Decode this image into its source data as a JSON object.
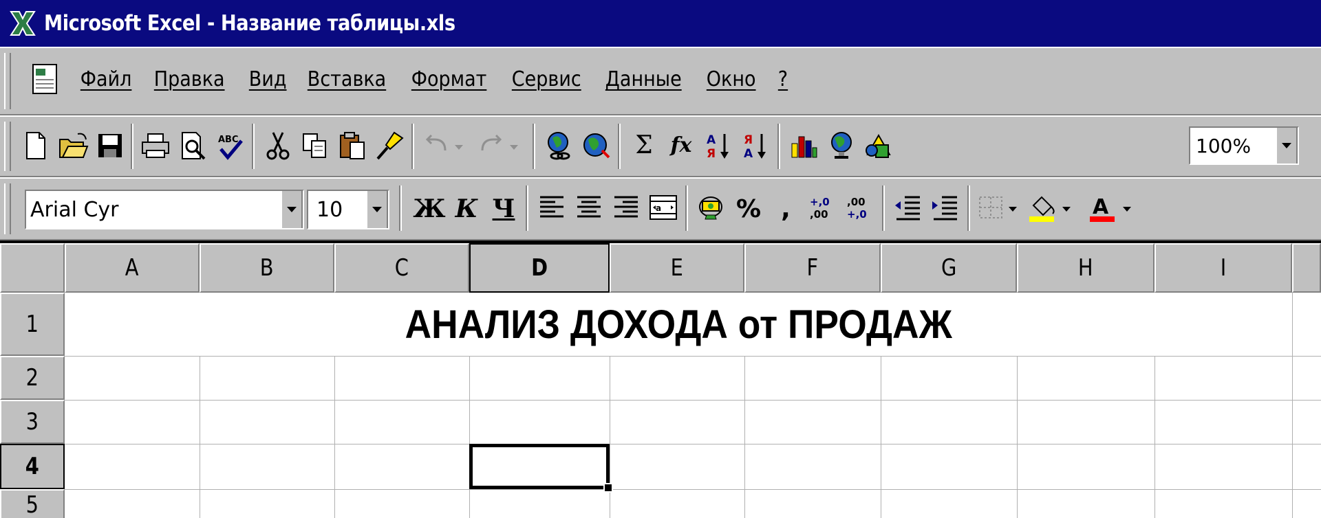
{
  "window": {
    "title": "Microsoft Excel - Название таблицы.xls",
    "colors": {
      "title_bar": "#0a0a80",
      "chrome": "#c0c0c0"
    }
  },
  "menu": {
    "items": [
      "Файл",
      "Правка",
      "Вид",
      "Вставка",
      "Формат",
      "Сервис",
      "Данные",
      "Окно",
      "?"
    ]
  },
  "toolbar_standard": {
    "icons": [
      "new-document-icon",
      "open-folder-icon",
      "save-icon",
      "print-icon",
      "print-preview-icon",
      "spelling-icon",
      "cut-icon",
      "copy-icon",
      "paste-icon",
      "format-painter-icon",
      "undo-icon",
      "redo-icon",
      "insert-hyperlink-icon",
      "web-toolbar-icon",
      "autosum-icon",
      "function-wizard-icon",
      "sort-ascending-icon",
      "sort-descending-icon",
      "chart-wizard-icon",
      "map-icon",
      "drawing-icon"
    ],
    "autosum_glyph": "Σ",
    "function_glyph": "fx",
    "zoom": "100%"
  },
  "toolbar_format": {
    "font_name": "Arial Cyr",
    "font_size": "10",
    "bold": "Ж",
    "italic": "К",
    "underline": "Ч",
    "percent": "%",
    "comma": ",",
    "increase_decimal": "+,0\n,00",
    "decrease_decimal": ",00\n+,0"
  },
  "sheet": {
    "columns": [
      "A",
      "B",
      "C",
      "D",
      "E",
      "F",
      "G",
      "H",
      "I"
    ],
    "rows": [
      "1",
      "2",
      "3",
      "4",
      "5"
    ],
    "active_column": "D",
    "active_row": "4",
    "title_cell": "АНАЛИЗ ДОХОДА от ПРОДАЖ"
  }
}
